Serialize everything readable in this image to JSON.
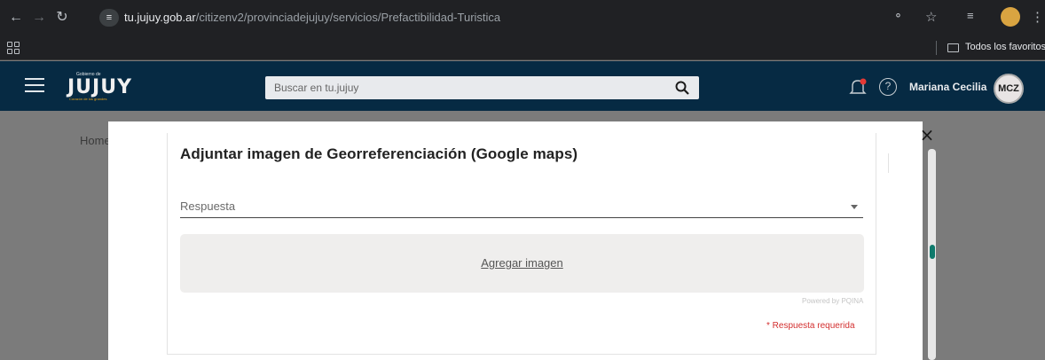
{
  "browser": {
    "url_host": "tu.jujuy.gob.ar",
    "url_path": "/citizenv2/provinciadejujuy/servicios/Prefactibilidad-Turistica",
    "bookmarks_label": "Todos los favoritos"
  },
  "header": {
    "logo_small": "Gobierno de",
    "logo_big": "JUJUY",
    "logo_tag": "Corazón de los grandes",
    "search_placeholder": "Buscar en tu.jujuy",
    "user_name": "Mariana Cecilia",
    "user_initials": "MCZ",
    "help_symbol": "?"
  },
  "page": {
    "breadcrumb": "Home"
  },
  "modal": {
    "close_symbol": "×",
    "question": "Adjuntar imagen de Georreferenciación (Google maps)",
    "select_placeholder": "Respuesta",
    "dropzone_label": "Agregar imagen",
    "powered_by": "Powered by PQINA",
    "required_text": "* Respuesta requerida"
  },
  "colors": {
    "header_bg": "#062a43",
    "scroll_thumb": "#0f7a6c",
    "required": "#d32f2f"
  },
  "icons": [
    "back-icon",
    "forward-icon",
    "reload-icon",
    "site-settings-icon",
    "password-key-icon",
    "star-icon",
    "reading-list-icon",
    "profile-icon",
    "kebab-menu-icon",
    "apps-icon",
    "folder-icon",
    "hamburger-icon",
    "search-icon",
    "bell-icon",
    "help-icon",
    "close-icon",
    "dropdown-arrow-icon"
  ]
}
